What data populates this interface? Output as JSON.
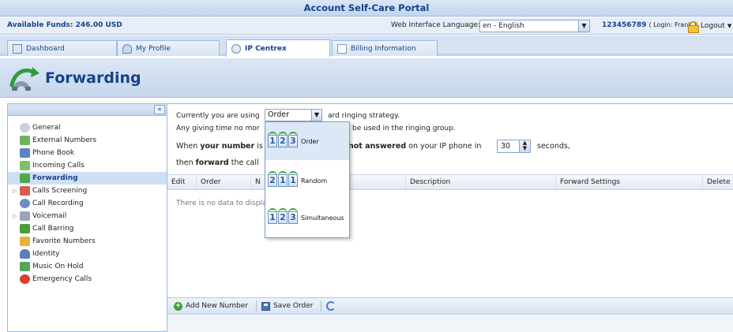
{
  "portal": {
    "title": "Account Self-Care Portal"
  },
  "infobar": {
    "available_funds": "Available Funds: 246.00 USD",
    "language_label": "Web Interface Language:",
    "language_value": "en - English",
    "account_number": "123456789",
    "login_text": "( Login: Frank )",
    "logout_label": "Logout"
  },
  "tabs": [
    {
      "label": "Dashboard"
    },
    {
      "label": "My Profile"
    },
    {
      "label": "IP Centrex",
      "active": true
    },
    {
      "label": "Billing Information"
    }
  ],
  "header": {
    "title": "Forwarding"
  },
  "sidebar": {
    "collapse_glyph": "«",
    "items": [
      {
        "label": "General"
      },
      {
        "label": "External Numbers"
      },
      {
        "label": "Phone Book"
      },
      {
        "label": "Incoming Calls"
      },
      {
        "label": "Forwarding",
        "selected": true
      },
      {
        "label": "Calls Screening"
      },
      {
        "label": "Call Recording"
      },
      {
        "label": "Voicemail"
      },
      {
        "label": "Call Barring"
      },
      {
        "label": "Favorite Numbers"
      },
      {
        "label": "Identity"
      },
      {
        "label": "Music On Hold"
      },
      {
        "label": "Emergency Calls"
      }
    ]
  },
  "main": {
    "line1_prefix": "Currently you are using",
    "line1_suffix": "ard ringing strategy.",
    "strategy_value": "Order",
    "line2_a": "Any giving time no mor",
    "line2_b": "be used in the ringing group.",
    "line3_when": "When",
    "line3_your_number": "your number",
    "line3_is": "is",
    "line3_not_answered": "not answered",
    "line3_rest": "on your IP phone in",
    "seconds_value": "30",
    "seconds_label": "seconds,",
    "line4_then": "then",
    "line4_forward": "forward",
    "line4_rest": "the call"
  },
  "grid": {
    "columns": [
      "Edit",
      "Order",
      "N",
      "Description",
      "Forward Settings",
      "Delete"
    ],
    "empty_text": "There is no data to display"
  },
  "toolbar": {
    "add_label": "Add New Number",
    "save_label": "Save Order"
  },
  "dropdown": {
    "options": [
      {
        "label": "Order",
        "digits": [
          "1",
          "2",
          "3"
        ]
      },
      {
        "label": "Random",
        "digits": [
          "2",
          "1",
          "1"
        ]
      },
      {
        "label": "Simultaneous",
        "digits": [
          "1",
          "2",
          "3"
        ]
      }
    ]
  }
}
